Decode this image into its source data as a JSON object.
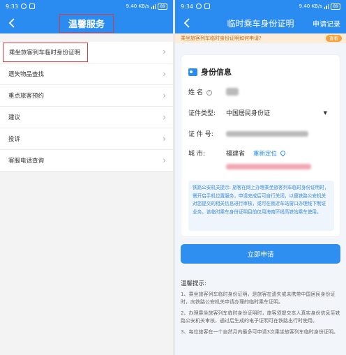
{
  "left": {
    "status": {
      "time": "9:33",
      "network": "9.40 KB/s",
      "battery": "89"
    },
    "title": "温馨服务",
    "menu": [
      {
        "label": "乘坐旅客列车临时身份证明"
      },
      {
        "label": "遗失物品查找"
      },
      {
        "label": "重点旅客预约"
      },
      {
        "label": "建议"
      },
      {
        "label": "投诉"
      },
      {
        "label": "客服电话查询"
      }
    ]
  },
  "right": {
    "status": {
      "time": "9:34",
      "network": "9.40 KB/s",
      "battery": "89"
    },
    "title": "临时乘车身份证明",
    "nav_right": "申请记录",
    "banner": {
      "text": "乘坐旅客列车临时身份证明如何申请?",
      "button": "查看"
    },
    "card": {
      "heading": "身份信息",
      "name_label": "姓  名",
      "id_type_label": "证件类型:",
      "id_type_value": "中国居民身份证",
      "id_no_label": "证 件 号:",
      "city_label": "城    市:",
      "city_value": "福建省",
      "relocate": "重新定位"
    },
    "notice": "铁路公安机关提示: 旅客在网上办理乘坐旅客列车临时身份证明时，需开启手机位置服务，申请完成后可自行关闭，以便铁路公安机关对您提交的相关信息进行审核，或可在就近车站窗口办理线下制证业务。该临时乘车身份证明目前仅用海南环线高铁站乘车使用。",
    "submit": "立即申请",
    "tips_title": "温馨提示:",
    "tips": [
      "1、乘坐旅客列车临时身份证明，是旅客在遗失或未携带中国居民身份证时，向铁路公安机关申请办理的临时乘车证明。",
      "2、办理乘坐旅客列车临时身份证明时，旅客须提交本人真实身份信息至铁路公安机关审核，通过后生成的电子证明可在铁路出行时使用。",
      "3、每位旅客在一个自然月内最多可申请3次乘坐旅客列车临时身份证明。"
    ]
  }
}
